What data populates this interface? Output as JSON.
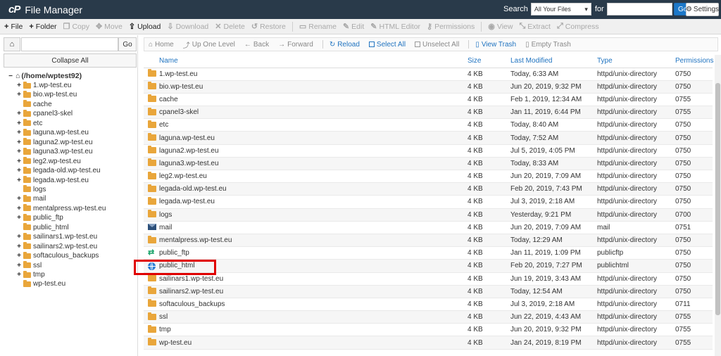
{
  "header": {
    "logo": "cP",
    "title": "File Manager",
    "search_label": "Search",
    "search_scope": "All Your Files",
    "for_label": "for",
    "search_value": "",
    "go_label": "Go",
    "settings_label": "Settings"
  },
  "toolbar": {
    "items": [
      {
        "label": "File",
        "icon": "plus-icon",
        "enabled": true
      },
      {
        "label": "Folder",
        "icon": "plus-icon",
        "enabled": true
      },
      {
        "label": "Copy",
        "icon": "copy-icon",
        "enabled": false
      },
      {
        "label": "Move",
        "icon": "move-icon",
        "enabled": false
      },
      {
        "label": "Upload",
        "icon": "upload-icon",
        "enabled": true
      },
      {
        "label": "Download",
        "icon": "download-icon",
        "enabled": false
      },
      {
        "label": "Delete",
        "icon": "delete-icon",
        "enabled": false
      },
      {
        "label": "Restore",
        "icon": "restore-icon",
        "enabled": false
      },
      {
        "label": "Rename",
        "icon": "rename-icon",
        "enabled": false
      },
      {
        "label": "Edit",
        "icon": "pencil-icon",
        "enabled": false
      },
      {
        "label": "HTML Editor",
        "icon": "html-editor-icon",
        "enabled": false
      },
      {
        "label": "Permissions",
        "icon": "key-icon",
        "enabled": false
      },
      {
        "label": "View",
        "icon": "eye-icon",
        "enabled": false
      },
      {
        "label": "Extract",
        "icon": "extract-icon",
        "enabled": false
      },
      {
        "label": "Compress",
        "icon": "compress-icon",
        "enabled": false
      }
    ]
  },
  "left": {
    "path_value": "",
    "go_label": "Go",
    "collapse_label": "Collapse All",
    "root_label": "(/home/wptest92)",
    "tree": [
      {
        "label": "1.wp-test.eu",
        "expandable": true
      },
      {
        "label": "bio.wp-test.eu",
        "expandable": true
      },
      {
        "label": "cache",
        "expandable": false
      },
      {
        "label": "cpanel3-skel",
        "expandable": true
      },
      {
        "label": "etc",
        "expandable": true
      },
      {
        "label": "laguna.wp-test.eu",
        "expandable": true
      },
      {
        "label": "laguna2.wp-test.eu",
        "expandable": true
      },
      {
        "label": "laguna3.wp-test.eu",
        "expandable": true
      },
      {
        "label": "leg2.wp-test.eu",
        "expandable": true
      },
      {
        "label": "legada-old.wp-test.eu",
        "expandable": true
      },
      {
        "label": "legada.wp-test.eu",
        "expandable": true
      },
      {
        "label": "logs",
        "expandable": false
      },
      {
        "label": "mail",
        "expandable": true
      },
      {
        "label": "mentalpress.wp-test.eu",
        "expandable": true
      },
      {
        "label": "public_ftp",
        "expandable": true
      },
      {
        "label": "public_html",
        "expandable": false
      },
      {
        "label": "sailinars1.wp-test.eu",
        "expandable": true
      },
      {
        "label": "sailinars2.wp-test.eu",
        "expandable": true
      },
      {
        "label": "softaculous_backups",
        "expandable": true
      },
      {
        "label": "ssl",
        "expandable": true
      },
      {
        "label": "tmp",
        "expandable": true
      },
      {
        "label": "wp-test.eu",
        "expandable": false
      }
    ]
  },
  "nav": {
    "items": [
      {
        "label": "Home",
        "icon": "home-icon",
        "style": "gray"
      },
      {
        "label": "Up One Level",
        "icon": "up-level-icon",
        "style": "gray"
      },
      {
        "label": "Back",
        "icon": "back-arrow-icon",
        "style": "gray"
      },
      {
        "label": "Forward",
        "icon": "forward-arrow-icon",
        "style": "gray"
      },
      {
        "label": "Reload",
        "icon": "reload-icon",
        "style": "blue"
      },
      {
        "label": "Select All",
        "icon": "checkbox-checked-icon",
        "style": "blue"
      },
      {
        "label": "Unselect All",
        "icon": "checkbox-icon",
        "style": "gray"
      },
      {
        "label": "View Trash",
        "icon": "trash-icon",
        "style": "blue"
      },
      {
        "label": "Empty Trash",
        "icon": "empty-trash-icon",
        "style": "gray"
      }
    ]
  },
  "table": {
    "columns": [
      "Name",
      "Size",
      "Last Modified",
      "Type",
      "Permissions"
    ],
    "rows": [
      {
        "icon": "folder-icon",
        "name": "1.wp-test.eu",
        "size": "4 KB",
        "modified": "Today, 6:33 AM",
        "type": "httpd/unix-directory",
        "perms": "0750"
      },
      {
        "icon": "folder-icon",
        "name": "bio.wp-test.eu",
        "size": "4 KB",
        "modified": "Jun 20, 2019, 9:32 PM",
        "type": "httpd/unix-directory",
        "perms": "0750"
      },
      {
        "icon": "folder-icon",
        "name": "cache",
        "size": "4 KB",
        "modified": "Feb 1, 2019, 12:34 AM",
        "type": "httpd/unix-directory",
        "perms": "0755"
      },
      {
        "icon": "folder-icon",
        "name": "cpanel3-skel",
        "size": "4 KB",
        "modified": "Jan 11, 2019, 6:44 PM",
        "type": "httpd/unix-directory",
        "perms": "0755"
      },
      {
        "icon": "folder-icon",
        "name": "etc",
        "size": "4 KB",
        "modified": "Today, 8:40 AM",
        "type": "httpd/unix-directory",
        "perms": "0750"
      },
      {
        "icon": "folder-icon",
        "name": "laguna.wp-test.eu",
        "size": "4 KB",
        "modified": "Today, 7:52 AM",
        "type": "httpd/unix-directory",
        "perms": "0750"
      },
      {
        "icon": "folder-icon",
        "name": "laguna2.wp-test.eu",
        "size": "4 KB",
        "modified": "Jul 5, 2019, 4:05 PM",
        "type": "httpd/unix-directory",
        "perms": "0750"
      },
      {
        "icon": "folder-icon",
        "name": "laguna3.wp-test.eu",
        "size": "4 KB",
        "modified": "Today, 8:33 AM",
        "type": "httpd/unix-directory",
        "perms": "0750"
      },
      {
        "icon": "folder-icon",
        "name": "leg2.wp-test.eu",
        "size": "4 KB",
        "modified": "Jun 20, 2019, 7:09 AM",
        "type": "httpd/unix-directory",
        "perms": "0750"
      },
      {
        "icon": "folder-icon",
        "name": "legada-old.wp-test.eu",
        "size": "4 KB",
        "modified": "Feb 20, 2019, 7:43 PM",
        "type": "httpd/unix-directory",
        "perms": "0750"
      },
      {
        "icon": "folder-icon",
        "name": "legada.wp-test.eu",
        "size": "4 KB",
        "modified": "Jul 3, 2019, 2:18 AM",
        "type": "httpd/unix-directory",
        "perms": "0750"
      },
      {
        "icon": "folder-icon",
        "name": "logs",
        "size": "4 KB",
        "modified": "Yesterday, 9:21 PM",
        "type": "httpd/unix-directory",
        "perms": "0700"
      },
      {
        "icon": "mail-icon",
        "name": "mail",
        "size": "4 KB",
        "modified": "Jun 20, 2019, 7:09 AM",
        "type": "mail",
        "perms": "0751"
      },
      {
        "icon": "folder-icon",
        "name": "mentalpress.wp-test.eu",
        "size": "4 KB",
        "modified": "Today, 12:29 AM",
        "type": "httpd/unix-directory",
        "perms": "0750"
      },
      {
        "icon": "ftp-arrows-icon",
        "name": "public_ftp",
        "size": "4 KB",
        "modified": "Jan 11, 2019, 1:09 PM",
        "type": "publicftp",
        "perms": "0750"
      },
      {
        "icon": "globe-icon",
        "name": "public_html",
        "size": "4 KB",
        "modified": "Feb 20, 2019, 7:27 PM",
        "type": "publichtml",
        "perms": "0750"
      },
      {
        "icon": "folder-icon",
        "name": "sailinars1.wp-test.eu",
        "size": "4 KB",
        "modified": "Jun 19, 2019, 3:43 AM",
        "type": "httpd/unix-directory",
        "perms": "0750"
      },
      {
        "icon": "folder-icon",
        "name": "sailinars2.wp-test.eu",
        "size": "4 KB",
        "modified": "Today, 12:54 AM",
        "type": "httpd/unix-directory",
        "perms": "0750"
      },
      {
        "icon": "folder-icon",
        "name": "softaculous_backups",
        "size": "4 KB",
        "modified": "Jul 3, 2019, 2:18 AM",
        "type": "httpd/unix-directory",
        "perms": "0711"
      },
      {
        "icon": "folder-icon",
        "name": "ssl",
        "size": "4 KB",
        "modified": "Jun 22, 2019, 4:43 AM",
        "type": "httpd/unix-directory",
        "perms": "0755"
      },
      {
        "icon": "folder-icon",
        "name": "tmp",
        "size": "4 KB",
        "modified": "Jun 20, 2019, 9:32 PM",
        "type": "httpd/unix-directory",
        "perms": "0755"
      },
      {
        "icon": "folder-icon",
        "name": "wp-test.eu",
        "size": "4 KB",
        "modified": "Jan 24, 2019, 8:19 PM",
        "type": "httpd/unix-directory",
        "perms": "0755"
      }
    ]
  },
  "colors": {
    "header_bg": "#293a4a",
    "accent_blue": "#1f73c0",
    "folder": "#e9a63b",
    "highlight": "#e00000"
  }
}
